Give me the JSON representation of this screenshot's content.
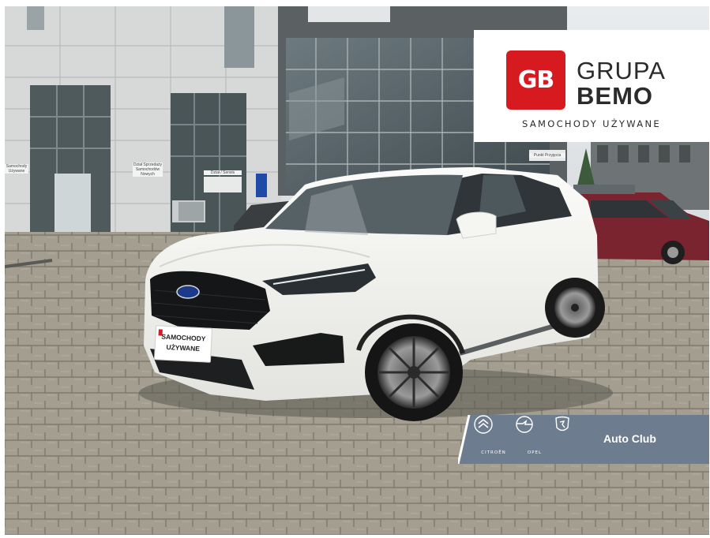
{
  "photo": {
    "subject": "white Ford Edge ST-Line SUV",
    "colors": {
      "car": "#f3f3f0",
      "pavement": "#9a9688",
      "brand_red": "#d71920",
      "banner": "#6b7a8e"
    }
  },
  "logo": {
    "mark": "GB",
    "line1": "GRUPA",
    "line2": "BEMO",
    "tagline": "SAMOCHODY UŻYWANE"
  },
  "banner": {
    "brands": [
      {
        "icon": "citroen-icon",
        "name": "CITROËN"
      },
      {
        "icon": "opel-icon",
        "name": "OPEL"
      },
      {
        "icon": "peugeot-icon",
        "name": ""
      }
    ],
    "label": "Auto Club"
  },
  "plate": {
    "line1": "SAMOCHODY",
    "line2": "UŻYWANE"
  },
  "signs": {
    "left": "Samochody Używane",
    "service": "Dział Sprzedaży Samochodów Nowych",
    "entrance": "Dział / Serwis",
    "right": "Punkt Przyjęcia"
  }
}
